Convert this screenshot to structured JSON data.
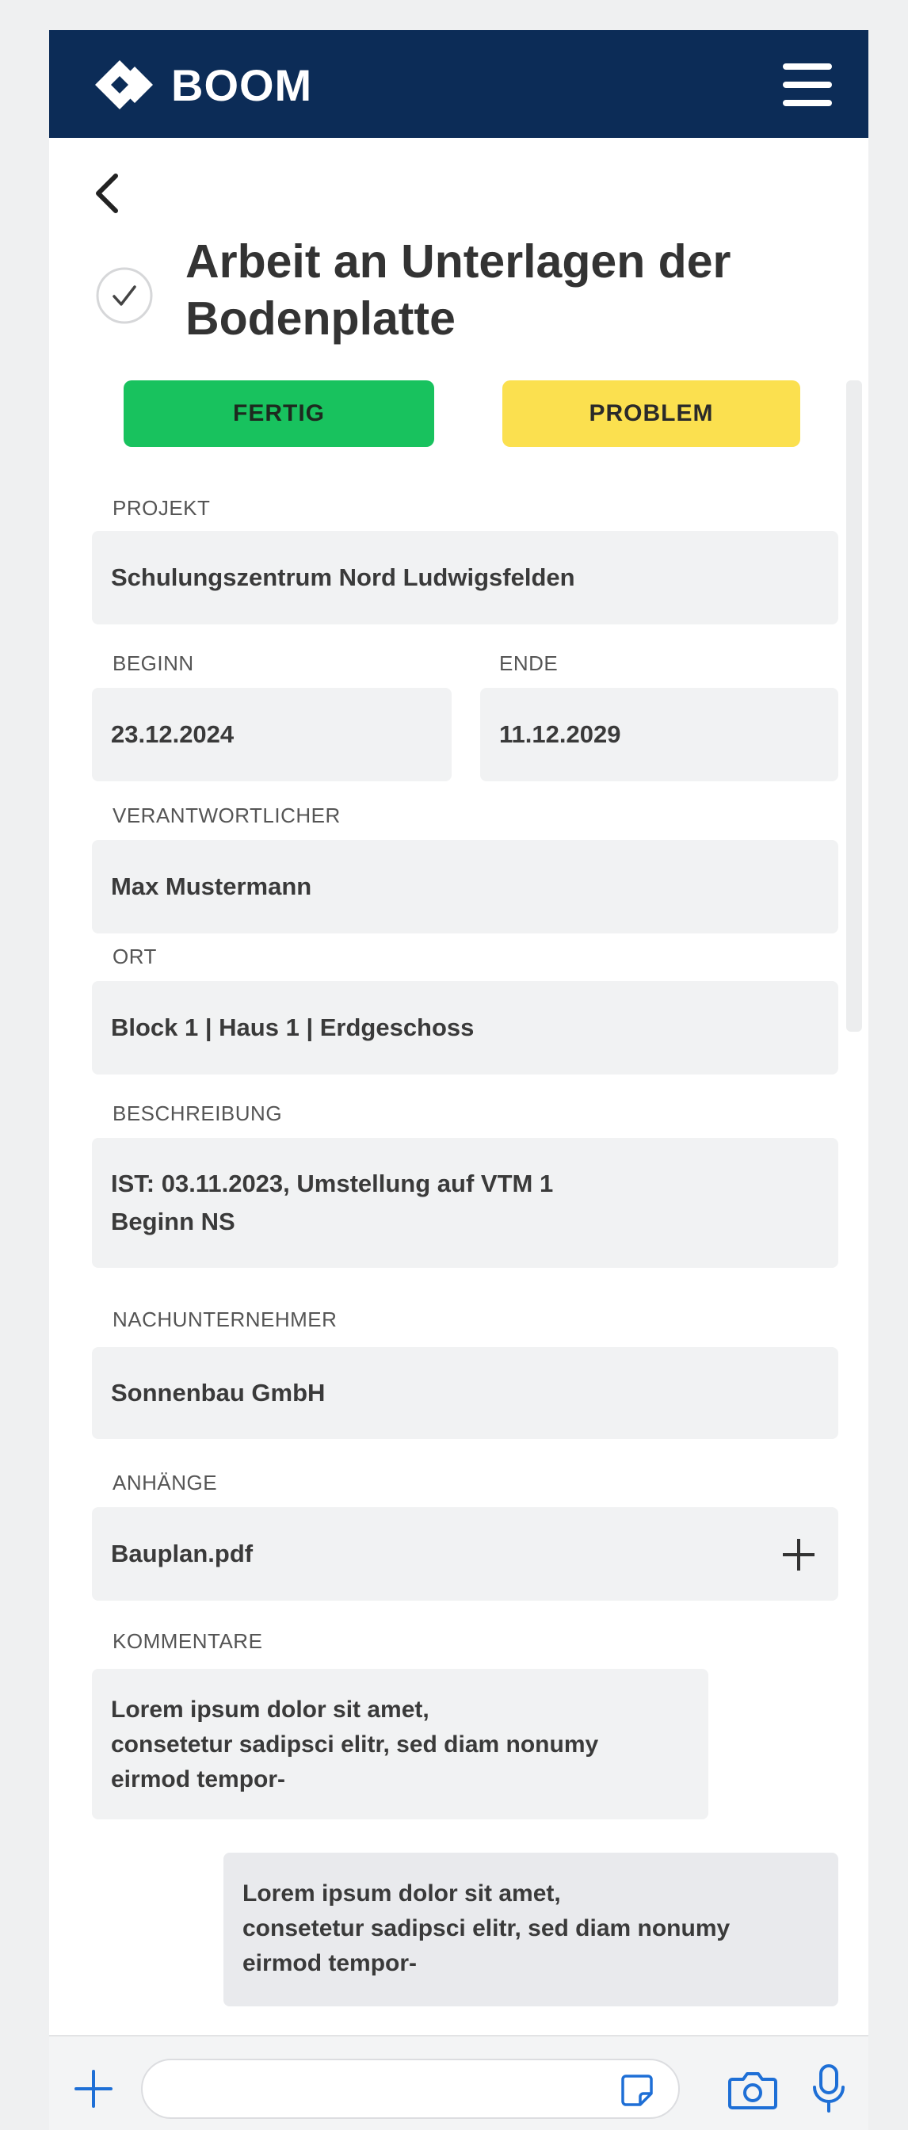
{
  "app": {
    "brand": "BOOM",
    "colors": {
      "header_bg": "#0c2c57",
      "done": "#18c25e",
      "problem": "#fbe04f",
      "accent": "#1e6fd6"
    }
  },
  "header": {
    "logo_icon": "diamond-arrow-logo",
    "menu_icon": "hamburger-menu-icon"
  },
  "task": {
    "title": "Arbeit an Unterlagen der Bodenplatte",
    "status_icon": "check-circle-icon"
  },
  "actions": {
    "done_label": "FERTIG",
    "problem_label": "PROBLEM"
  },
  "fields": {
    "projekt": {
      "label": "PROJEKT",
      "value": "Schulungszentrum Nord Ludwigsfelden"
    },
    "beginn": {
      "label": "BEGINN",
      "value": "23.12.2024"
    },
    "ende": {
      "label": "ENDE",
      "value": "11.12.2029"
    },
    "verantwortlicher": {
      "label": "VERANTWORTLICHER",
      "value": "Max Mustermann"
    },
    "ort": {
      "label": "ORT",
      "value": "Block 1 | Haus 1 | Erdgeschoss"
    },
    "beschreibung": {
      "label": "BESCHREIBUNG",
      "lines": [
        "IST: 03.11.2023, Umstellung auf VTM 1",
        "Beginn NS"
      ]
    },
    "nachunternehmer": {
      "label": "NACHUNTERNEHMER",
      "value": "Sonnenbau GmbH"
    },
    "anhaenge": {
      "label": "ANHÄNGE",
      "file": "Bauplan.pdf"
    }
  },
  "comments": {
    "label": "KOMMENTARE",
    "items": [
      {
        "lines": [
          "Lorem ipsum dolor sit amet,",
          "consetetur sadipsci elitr, sed diam nonumy",
          "eirmod tempor-"
        ]
      },
      {
        "lines": [
          "Lorem ipsum dolor sit amet,",
          "consetetur sadipsci elitr, sed diam nonumy",
          "eirmod tempor-"
        ]
      }
    ]
  },
  "composer": {
    "placeholder": "",
    "icons": [
      "plus-icon",
      "sticker-icon",
      "camera-icon",
      "microphone-icon"
    ]
  }
}
